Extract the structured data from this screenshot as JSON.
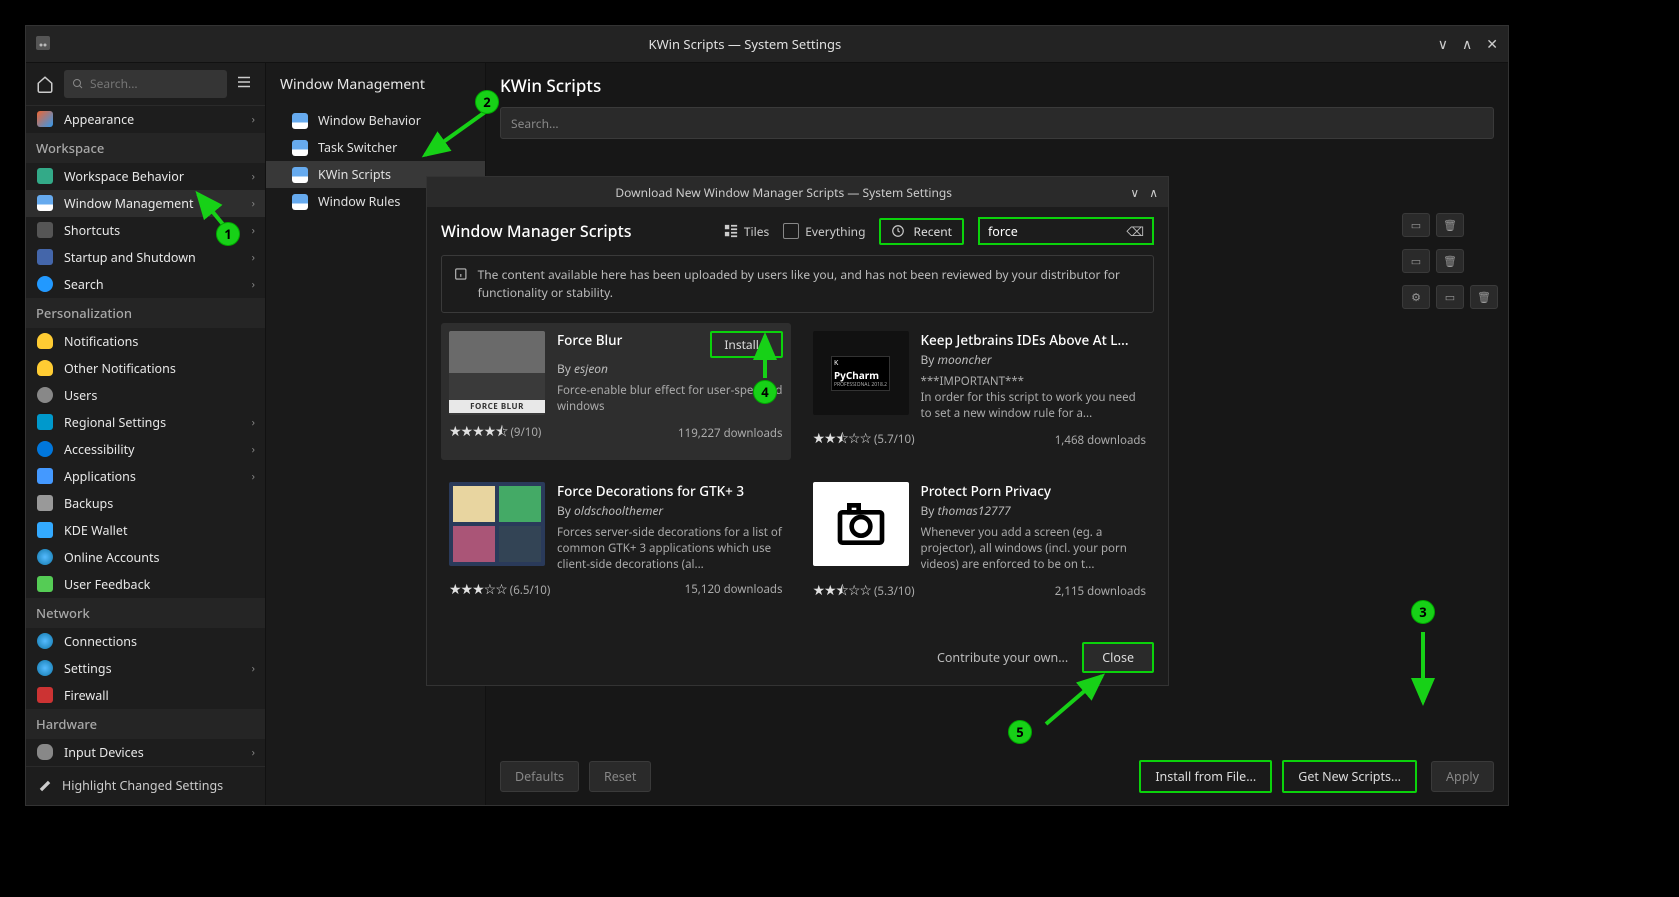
{
  "window": {
    "title": "KWin Scripts — System Settings",
    "search_placeholder": "Search..."
  },
  "sidebar": {
    "categories": [
      {
        "type": "item",
        "label": "Appearance",
        "icon": "ic-appearance",
        "chev": true
      },
      {
        "type": "header",
        "label": "Workspace"
      },
      {
        "type": "item",
        "label": "Workspace Behavior",
        "icon": "ic-workspace",
        "chev": true
      },
      {
        "type": "item",
        "label": "Window Management",
        "icon": "ic-window",
        "chev": true,
        "highlight": true
      },
      {
        "type": "item",
        "label": "Shortcuts",
        "icon": "ic-shortcuts",
        "chev": true
      },
      {
        "type": "item",
        "label": "Startup and Shutdown",
        "icon": "ic-startup",
        "chev": true
      },
      {
        "type": "item",
        "label": "Search",
        "icon": "ic-search",
        "chev": true
      },
      {
        "type": "header",
        "label": "Personalization"
      },
      {
        "type": "item",
        "label": "Notifications",
        "icon": "ic-bell",
        "chev": false
      },
      {
        "type": "item",
        "label": "Other Notifications",
        "icon": "ic-bell",
        "chev": false
      },
      {
        "type": "item",
        "label": "Users",
        "icon": "ic-user",
        "chev": false
      },
      {
        "type": "item",
        "label": "Regional Settings",
        "icon": "ic-flag",
        "chev": true
      },
      {
        "type": "item",
        "label": "Accessibility",
        "icon": "ic-access",
        "chev": true
      },
      {
        "type": "item",
        "label": "Applications",
        "icon": "ic-apps",
        "chev": true
      },
      {
        "type": "item",
        "label": "Backups",
        "icon": "ic-backup",
        "chev": false
      },
      {
        "type": "item",
        "label": "KDE Wallet",
        "icon": "ic-wallet",
        "chev": false
      },
      {
        "type": "item",
        "label": "Online Accounts",
        "icon": "ic-globe",
        "chev": false
      },
      {
        "type": "item",
        "label": "User Feedback",
        "icon": "ic-feedback",
        "chev": false
      },
      {
        "type": "header",
        "label": "Network"
      },
      {
        "type": "item",
        "label": "Connections",
        "icon": "ic-globe",
        "chev": false
      },
      {
        "type": "item",
        "label": "Settings",
        "icon": "ic-globe",
        "chev": true
      },
      {
        "type": "item",
        "label": "Firewall",
        "icon": "ic-firewall",
        "chev": false
      },
      {
        "type": "header",
        "label": "Hardware"
      },
      {
        "type": "item",
        "label": "Input Devices",
        "icon": "ic-mouse",
        "chev": true
      }
    ],
    "footer": "Highlight Changed Settings"
  },
  "subnav": {
    "header": "Window Management",
    "items": [
      {
        "label": "Window Behavior",
        "active": false
      },
      {
        "label": "Task Switcher",
        "active": false
      },
      {
        "label": "KWin Scripts",
        "active": true
      },
      {
        "label": "Window Rules",
        "active": false
      }
    ]
  },
  "main": {
    "title": "KWin Scripts",
    "search_placeholder": "Search...",
    "defaults_btn": "Defaults",
    "reset_btn": "Reset",
    "install_file_btn": "Install from File...",
    "get_new_btn": "Get New Scripts...",
    "apply_btn": "Apply"
  },
  "dialog": {
    "titlebar": "Download New Window Manager Scripts — System Settings",
    "title": "Window Manager Scripts",
    "tiles_label": "Tiles",
    "everything_label": "Everything",
    "recent_label": "Recent",
    "search_value": "force",
    "banner": "The content available here has been uploaded by users like you, and has not been reviewed by your distributor for functionality or stability.",
    "contribute": "Contribute your own...",
    "close_btn": "Close",
    "install_btn": "Install...",
    "by_label": "By",
    "downloads_label": "downloads",
    "cards": [
      {
        "title": "Force Blur",
        "author": "esjeon",
        "desc": "Force-enable blur effect for user-specified windows",
        "rating": "★★★★⯪",
        "score": "(9/10)",
        "downloads": "119,227",
        "selected": true,
        "thumb": "forceblur",
        "thumb_label": "FORCE BLUR",
        "install": true
      },
      {
        "title": "Keep Jetbrains IDEs Above At L...",
        "author": "mooncher",
        "desc": "***IMPORTANT***\nIn order for this script to work you need to set a new window rule for a...",
        "rating": "★★⯪☆☆",
        "score": "(5.7/10)",
        "downloads": "1,468",
        "thumb": "pycharm"
      },
      {
        "title": "Force Decorations for GTK+ 3",
        "author": "oldschoolthemer",
        "desc": "Forces server-side decorations for a list of common GTK+ 3 applications which use client-side decorations (al...",
        "rating": "★★★☆☆",
        "score": "(6.5/10)",
        "downloads": "15,120",
        "thumb": "gtk"
      },
      {
        "title": "Protect Porn Privacy",
        "author": "thomas12777",
        "desc": "Whenever you add a screen (eg. a projector), all windows (incl. your porn videos) are enforced to be on t...",
        "rating": "★★⯪☆☆",
        "score": "(5.3/10)",
        "downloads": "2,115",
        "thumb": "camera"
      }
    ]
  },
  "annotations": [
    "1",
    "2",
    "3",
    "4",
    "5"
  ]
}
